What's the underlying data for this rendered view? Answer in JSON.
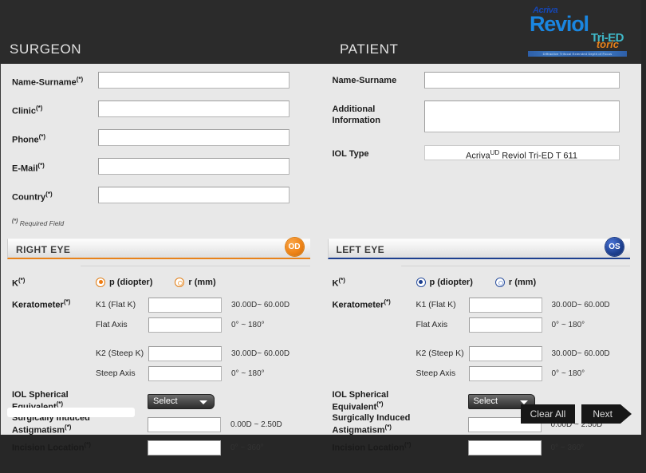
{
  "logo": {
    "acriva": "Acriva",
    "reviol": "Reviol",
    "tri_ed": "Tri-ED",
    "toric": "toric",
    "strip": "Diffractive Trifocal Extended Depth of Focus"
  },
  "headers": {
    "surgeon": "SURGEON",
    "patient": "PATIENT"
  },
  "surgeon": {
    "fields": [
      {
        "label": "Name-Surname",
        "required": "(*)",
        "value": "",
        "placeholder": ""
      },
      {
        "label": "Clinic",
        "required": "(*)",
        "value": "",
        "placeholder": ""
      },
      {
        "label": "Phone",
        "required": "(*)",
        "value": "",
        "placeholder": ""
      },
      {
        "label": "E-Mail",
        "required": "(*)",
        "value": "",
        "placeholder": ""
      },
      {
        "label": "Country",
        "required": "(*)",
        "value": "",
        "placeholder": ""
      }
    ],
    "required_note_mark": "(*)",
    "required_note_text": "Required Field"
  },
  "patient": {
    "name_label": "Name-Surname",
    "name_value": "",
    "additional_label_line1": "Additional",
    "additional_label_line2": "Information",
    "additional_value": "",
    "iol_type_label": "IOL Type",
    "iol_type_brand": "Acriva",
    "iol_type_sup": "UD",
    "iol_type_model": "Reviol Tri-ED T 611"
  },
  "right_eye": {
    "title": "RIGHT EYE",
    "badge": "OD",
    "accent": "#e8821a",
    "k_label": "K",
    "k_required": "(*)",
    "radio_p_label": "p (diopter)",
    "radio_r_label": "r (mm)",
    "radio_selected": "p",
    "keratometer_label": "Keratometer",
    "keratometer_required": "(*)",
    "rows": [
      {
        "label": "K1 (Flat K)",
        "value": "",
        "hint": "30.00D~ 60.00D"
      },
      {
        "label": "Flat Axis",
        "value": "",
        "hint": "0° ~ 180°"
      },
      {
        "label": "K2 (Steep K)",
        "value": "",
        "hint": "30.00D~ 60.00D"
      },
      {
        "label": "Steep Axis",
        "value": "",
        "hint": "0° ~ 180°"
      }
    ],
    "iol_se_label_line1": "IOL Spherical",
    "iol_se_label_line2": "Equivalent",
    "iol_se_required": "(*)",
    "iol_se_value": "Select",
    "sia_label": "Surgically Induced Astigmatism",
    "sia_required": "(*)",
    "sia_value": "",
    "sia_hint": "0.00D ~ 2.50D",
    "incision_label": "Incision Location",
    "incision_required": "(*)",
    "incision_value": "",
    "incision_hint": "0° ~ 360°"
  },
  "left_eye": {
    "title": "LEFT EYE",
    "badge": "OS",
    "accent": "#1d3f8f",
    "k_label": "K",
    "k_required": "(*)",
    "radio_p_label": "p (diopter)",
    "radio_r_label": "r (mm)",
    "radio_selected": "p",
    "keratometer_label": "Keratometer",
    "keratometer_required": "(*)",
    "rows": [
      {
        "label": "K1 (Flat K)",
        "value": "",
        "hint": "30.00D~ 60.00D"
      },
      {
        "label": "Flat Axis",
        "value": "",
        "hint": "0° ~ 180°"
      },
      {
        "label": "K2 (Steep K)",
        "value": "",
        "hint": "30.00D~ 60.00D"
      },
      {
        "label": "Steep Axis",
        "value": "",
        "hint": "0° ~ 180°"
      }
    ],
    "iol_se_label_line1": "IOL Spherical",
    "iol_se_label_line2": "Equivalent",
    "iol_se_required": "(*)",
    "iol_se_value": "Select",
    "sia_label": "Surgically Induced Astigmatism",
    "sia_required": "(*)",
    "sia_value": "",
    "sia_hint": "0.00D ~ 2.50D",
    "incision_label": "Incision Location",
    "incision_required": "(*)",
    "incision_value": "",
    "incision_hint": "0° ~ 360°"
  },
  "footer": {
    "clear_all": "Clear All",
    "next": "Next"
  }
}
